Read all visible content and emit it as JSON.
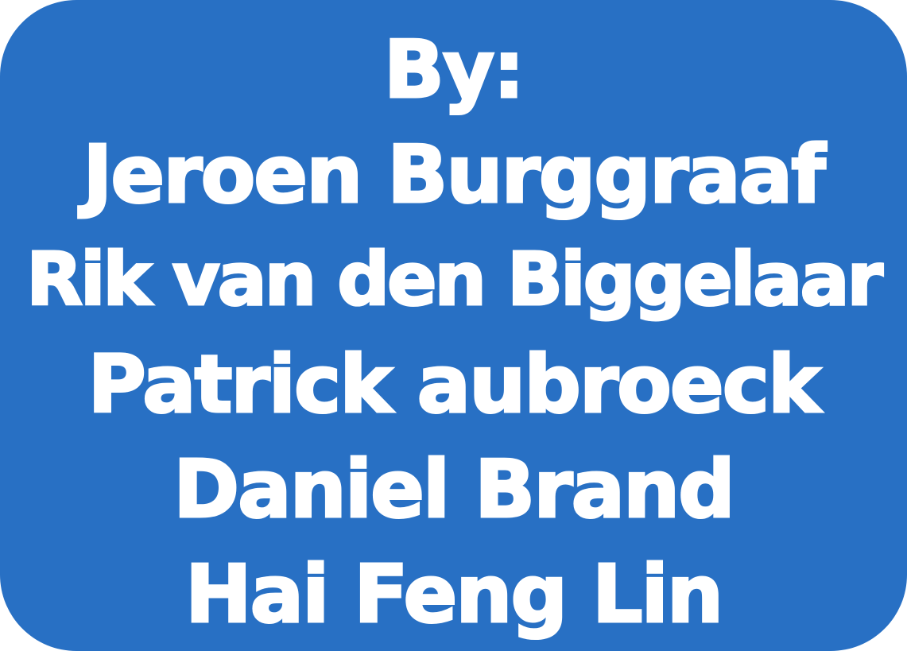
{
  "credits": {
    "heading": "By:",
    "names": [
      "Jeroen Burggraaf",
      "Rik van den Biggelaar",
      "Patrick aubroeck",
      "Daniel Brand",
      "Hai Feng Lin"
    ]
  },
  "colors": {
    "background": "#2870c4",
    "text": "#ffffff"
  }
}
